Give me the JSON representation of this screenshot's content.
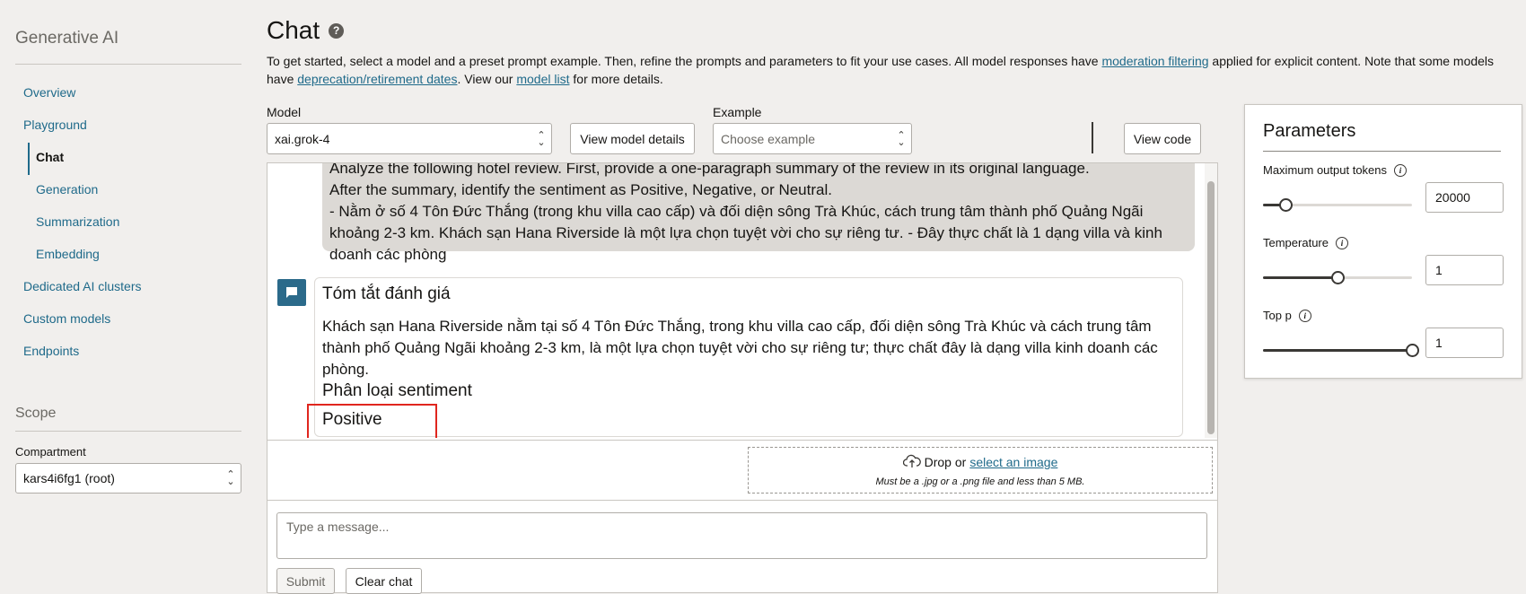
{
  "sidebar": {
    "app_title": "Generative AI",
    "items": [
      {
        "label": "Overview"
      },
      {
        "label": "Playground"
      },
      {
        "label": "Chat"
      },
      {
        "label": "Generation"
      },
      {
        "label": "Summarization"
      },
      {
        "label": "Embedding"
      },
      {
        "label": "Dedicated AI clusters"
      },
      {
        "label": "Custom models"
      },
      {
        "label": "Endpoints"
      }
    ],
    "active_item": "Chat",
    "scope_title": "Scope",
    "compartment_label": "Compartment",
    "compartment_value": "kars4i6fg1 (root)"
  },
  "header": {
    "title": "Chat",
    "help_icon": "question-circle-icon",
    "intro_prefix": "To get started, select a model and a preset prompt example. Then, refine the prompts and parameters to fit your use cases. All model responses have ",
    "link_moderation": "moderation filtering",
    "intro_middle": " applied for explicit content. Note that some models have ",
    "link_deprecation": "deprecation/retirement dates",
    "intro_view": ". View our ",
    "link_model_list": "model list",
    "intro_suffix": " for more details."
  },
  "controls": {
    "model_label": "Model",
    "model_value": "xai.grok-4",
    "view_model_details": "View model details",
    "example_label": "Example",
    "example_placeholder": "Choose example",
    "view_code": "View code"
  },
  "chat": {
    "user_message": [
      "Analyze the following hotel review. First, provide a one-paragraph summary of the review in its original language.",
      "After the summary, identify the sentiment as Positive, Negative, or Neutral.",
      "- Nằm ở số 4 Tôn Đức Thắng (trong khu villa cao cấp) và đối diện sông Trà Khúc, cách trung tâm thành phố Quảng Ngãi khoảng 2-3 km. Khách sạn Hana Riverside là một lựa chọn tuyệt vời cho sự riêng tư. - Đây thực chất là 1 dạng villa và kinh doanh các phòng"
    ],
    "bot_avatar_icon": "chat-bubble-icon",
    "response": {
      "heading": "Tóm tắt đánh giá",
      "body": "Khách sạn Hana Riverside nằm tại số 4 Tôn Đức Thắng, trong khu villa cao cấp, đối diện sông Trà Khúc và cách trung tâm thành phố Quảng Ngãi khoảng 2-3 km, là một lựa chọn tuyệt vời cho sự riêng tư; thực chất đây là dạng villa kinh doanh các phòng.",
      "sentiment_heading": "Phân loại sentiment",
      "sentiment": "Positive"
    },
    "highlight_color": "#e0261e"
  },
  "upload": {
    "icon": "cloud-upload-icon",
    "drop_text": "Drop or ",
    "select_link": "select an image",
    "hint": "Must be a .jpg or a .png file and less than 5 MB."
  },
  "composer": {
    "placeholder": "Type a message...",
    "submit_label": "Submit",
    "clear_label": "Clear chat"
  },
  "parameters": {
    "title": "Parameters",
    "max_tokens_label": "Maximum output tokens",
    "max_tokens_value": "20000",
    "max_tokens_fraction": 0.15,
    "temperature_label": "Temperature",
    "temperature_value": "1",
    "temperature_fraction": 0.5,
    "top_p_label": "Top p",
    "top_p_value": "1",
    "top_p_fraction": 1.0,
    "info_icon": "info-icon"
  },
  "colors": {
    "link": "#1f6a8a",
    "accent": "#2b6a8a",
    "highlight": "#e0261e"
  }
}
